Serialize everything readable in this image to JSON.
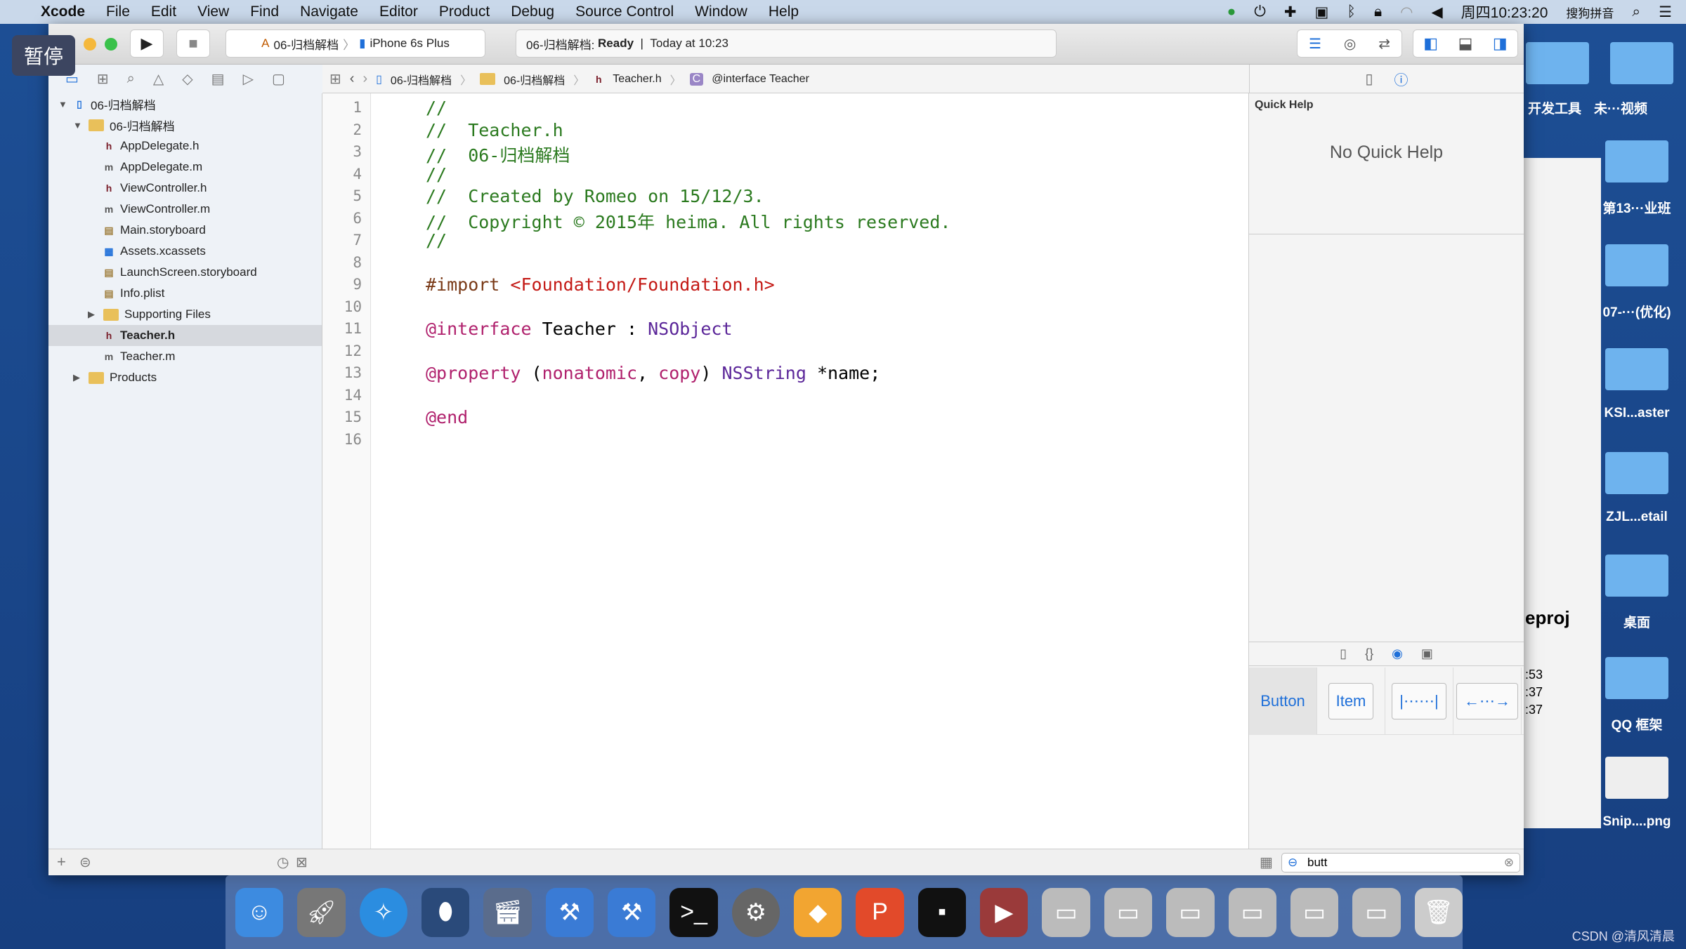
{
  "menubar": {
    "app": "Xcode",
    "items": [
      "File",
      "Edit",
      "View",
      "Find",
      "Navigate",
      "Editor",
      "Product",
      "Debug",
      "Source Control",
      "Window",
      "Help"
    ],
    "clock": "周四10:23:20",
    "ime": "搜狗拼音"
  },
  "overlay": {
    "pause": "暂停"
  },
  "toolbar": {
    "scheme": "06-归档解档",
    "device": "iPhone 6s Plus",
    "status_project": "06-归档解档:",
    "status_state": "Ready",
    "status_time": "Today at 10:23"
  },
  "jumpbar": [
    "06-归档解档",
    "06-归档解档",
    "Teacher.h",
    "@interface Teacher"
  ],
  "navigator": [
    {
      "label": "06-归档解档",
      "kind": "project",
      "indent": 0,
      "open": true
    },
    {
      "label": "06-归档解档",
      "kind": "folder",
      "indent": 1,
      "open": true
    },
    {
      "label": "AppDelegate.h",
      "kind": "h",
      "indent": 2
    },
    {
      "label": "AppDelegate.m",
      "kind": "m",
      "indent": 2
    },
    {
      "label": "ViewController.h",
      "kind": "h",
      "indent": 2
    },
    {
      "label": "ViewController.m",
      "kind": "m",
      "indent": 2
    },
    {
      "label": "Main.storyboard",
      "kind": "sb",
      "indent": 2
    },
    {
      "label": "Assets.xcassets",
      "kind": "assets",
      "indent": 2
    },
    {
      "label": "LaunchScreen.storyboard",
      "kind": "sb",
      "indent": 2
    },
    {
      "label": "Info.plist",
      "kind": "plist",
      "indent": 2
    },
    {
      "label": "Supporting Files",
      "kind": "folder",
      "indent": 2,
      "open": false
    },
    {
      "label": "Teacher.h",
      "kind": "h",
      "indent": 2,
      "selected": true
    },
    {
      "label": "Teacher.m",
      "kind": "m",
      "indent": 2
    },
    {
      "label": "Products",
      "kind": "folder",
      "indent": 1,
      "open": false
    }
  ],
  "code": [
    "//",
    "//  Teacher.h",
    "//  06-归档解档",
    "//",
    "//  Created by Romeo on 15/12/3.",
    "//  Copyright © 2015年 heima. All rights reserved.",
    "//",
    "",
    "#import <Foundation/Foundation.h>",
    "",
    "@interface Teacher : NSObject",
    "",
    "@property (nonatomic, copy) NSString *name;",
    "",
    "@end",
    ""
  ],
  "inspector": {
    "title": "Quick Help",
    "empty": "No Quick Help"
  },
  "library": {
    "items": [
      "Button",
      "Item"
    ],
    "search": "butt"
  },
  "desktop": {
    "labels": [
      "开发工具",
      "未···视频",
      "第13···业班",
      "07-···(优化)",
      "KSI...aster",
      "ZJL...etail",
      "桌面",
      "QQ 框架",
      "Snip....png"
    ],
    "partial": [
      "eproj",
      ":53",
      ":37",
      ":37"
    ]
  },
  "watermark": "CSDN @清风清晨"
}
